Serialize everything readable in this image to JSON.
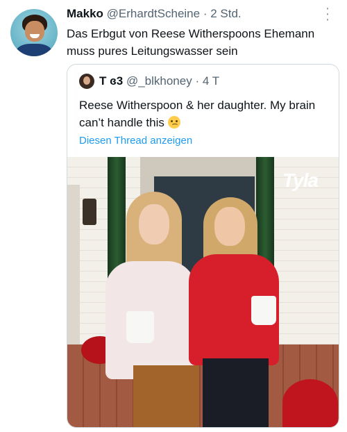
{
  "tweet": {
    "display_name": "Makko",
    "handle": "@ErhardtScheine",
    "separator": " · ",
    "time": "2 Std.",
    "text": "Das Erbgut von Reese Witherspoons Ehemann muss pures Leitungswasser sein"
  },
  "quoted_tweet": {
    "display_name": "T ɞ3",
    "handle": "@_blkhoney",
    "separator": " · ",
    "time": "4 T",
    "text": "Reese Witherspoon & her daughter. My brain can’t handle this",
    "emoji": "woozy-face",
    "show_thread": "Diesen Thread anzeigen",
    "image_logo": "Tyla"
  },
  "colors": {
    "link": "#1d9bf0",
    "muted": "#536471",
    "border": "#cfd9de"
  }
}
